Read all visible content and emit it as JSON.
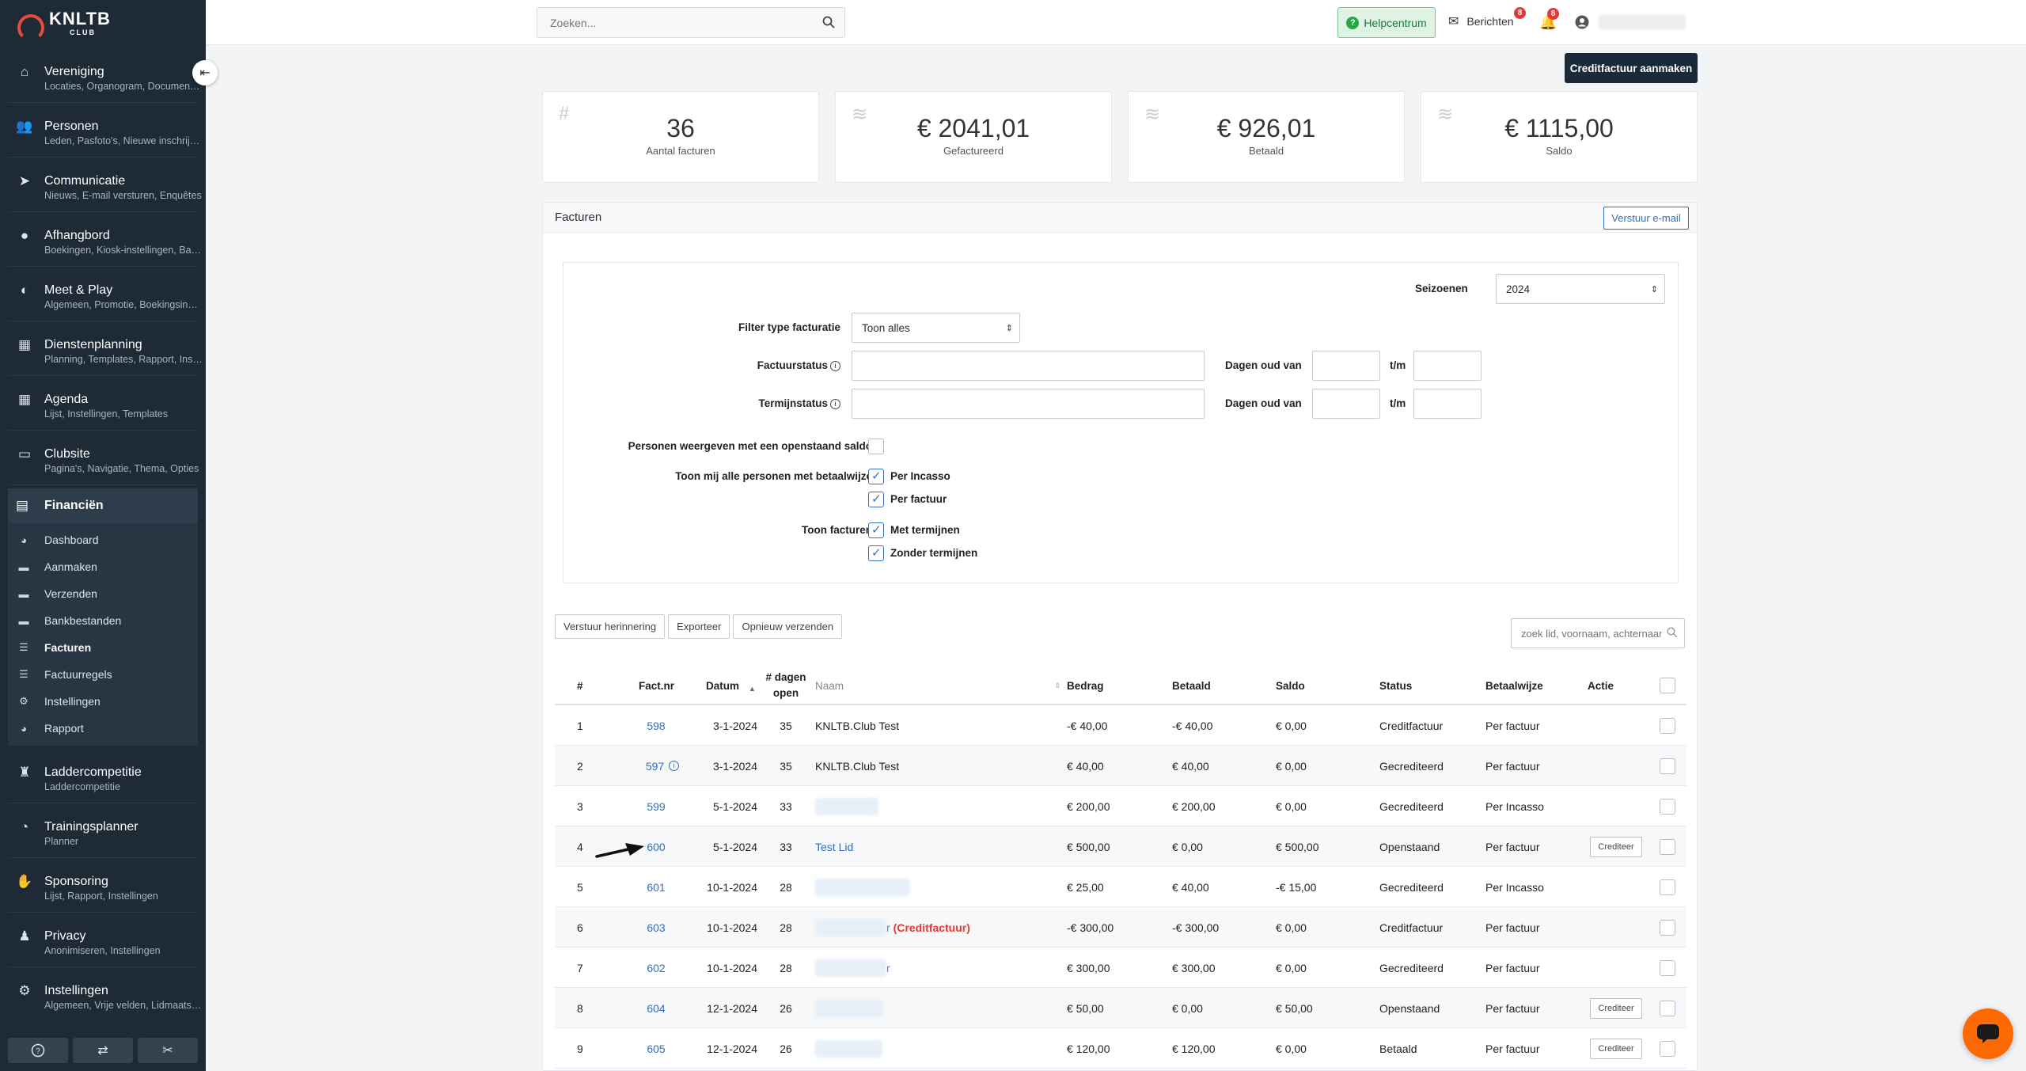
{
  "app": {
    "logo_text": "KNLTB",
    "logo_sub": "CLUB"
  },
  "sidebar": {
    "items": [
      {
        "label": "Vereniging",
        "sub": "Locaties, Organogram, Documenten",
        "icon": "home-icon"
      },
      {
        "label": "Personen",
        "sub": "Leden, Pasfoto's, Nieuwe inschrijvingen",
        "icon": "users-icon"
      },
      {
        "label": "Communicatie",
        "sub": "Nieuws, E-mail versturen, Enquêtes",
        "icon": "paper-plane-icon"
      },
      {
        "label": "Afhangbord",
        "sub": "Boekingen, Kiosk-instellingen, Banen",
        "icon": "ball-icon"
      },
      {
        "label": "Meet & Play",
        "sub": "Algemeen, Promotie, Boekingsinstellingen",
        "icon": "meet-play-icon"
      },
      {
        "label": "Dienstenplanning",
        "sub": "Planning, Templates, Rapport, Instellingen",
        "icon": "schedule-icon"
      },
      {
        "label": "Agenda",
        "sub": "Lijst, Instellingen, Templates",
        "icon": "calendar-icon"
      },
      {
        "label": "Clubsite",
        "sub": "Pagina's, Navigatie, Thema, Opties",
        "icon": "website-icon"
      }
    ],
    "finance": {
      "label": "Financiën",
      "items": [
        {
          "label": "Dashboard",
          "icon": "dashboard-icon"
        },
        {
          "label": "Aanmaken",
          "icon": "create-icon"
        },
        {
          "label": "Verzenden",
          "icon": "send-icon"
        },
        {
          "label": "Bankbestanden",
          "icon": "bank-file-icon"
        },
        {
          "label": "Facturen",
          "icon": "list-icon",
          "active": true
        },
        {
          "label": "Factuurregels",
          "icon": "list-icon"
        },
        {
          "label": "Instellingen",
          "icon": "settings-icon"
        },
        {
          "label": "Rapport",
          "icon": "report-icon"
        }
      ]
    },
    "items_after": [
      {
        "label": "Laddercompetitie",
        "sub": "Laddercompetitie",
        "icon": "trophy-icon"
      },
      {
        "label": "Trainingsplanner",
        "sub": "Planner",
        "icon": "training-icon"
      },
      {
        "label": "Sponsoring",
        "sub": "Lijst, Rapport, Instellingen",
        "icon": "sponsoring-icon"
      },
      {
        "label": "Privacy",
        "sub": "Anonimiseren, Instellingen",
        "icon": "privacy-icon"
      },
      {
        "label": "Instellingen",
        "sub": "Algemeen, Vrije velden, Lidmaatschappen",
        "icon": "settings-icon"
      }
    ]
  },
  "topbar": {
    "search_placeholder": "Zoeken...",
    "help_label": "Helpcentrum",
    "messages_label": "Berichten",
    "messages_count": "8",
    "notifications_count": "8"
  },
  "main": {
    "credit_button": "Creditfactuur aanmaken",
    "stats": [
      {
        "value": "36",
        "label": "Aantal facturen",
        "icon": "hash-icon"
      },
      {
        "value": "€ 2041,01",
        "label": "Gefactureerd",
        "icon": "coins-icon"
      },
      {
        "value": "€ 926,01",
        "label": "Betaald",
        "icon": "coins-icon"
      },
      {
        "value": "€ 1115,00",
        "label": "Saldo",
        "icon": "coins-icon"
      }
    ],
    "panel_title": "Facturen",
    "email_button": "Verstuur e-mail",
    "filters": {
      "season_label": "Seizoenen",
      "season_value": "2024",
      "type_label": "Filter type facturatie",
      "type_value": "Toon alles",
      "invoice_status_label": "Factuurstatus",
      "term_status_label": "Termijnstatus",
      "days_old_label": "Dagen oud van",
      "to_label": "t/m",
      "open_balance_label": "Personen weergeven met een openstaand saldo",
      "payment_method_label": "Toon mij alle personen met betaalwijze",
      "per_incasso": "Per Incasso",
      "per_factuur": "Per factuur",
      "show_invoices_label": "Toon facturen",
      "with_terms": "Met termijnen",
      "without_terms": "Zonder termijnen"
    },
    "actions": [
      "Verstuur herinnering",
      "Exporteer",
      "Opnieuw verzenden"
    ],
    "table_search_placeholder": "zoek lid, voornaam, achternaam",
    "table": {
      "headers": {
        "num": "#",
        "factnr": "Fact.nr",
        "datum": "Datum",
        "dagen": "# dagen open",
        "naam": "Naam",
        "bedrag": "Bedrag",
        "betaald": "Betaald",
        "saldo": "Saldo",
        "status": "Status",
        "betaalwijze": "Betaalwijze",
        "actie": "Actie"
      },
      "rows": [
        {
          "num": "1",
          "factnr": "598",
          "datum": "3-1-2024",
          "dagen": "35",
          "naam": "KNLTB.Club Test",
          "bedrag": "-€ 40,00",
          "betaald": "-€ 40,00",
          "saldo": "€ 0,00",
          "status": "Creditfactuur",
          "betaalwijze": "Per factuur"
        },
        {
          "num": "2",
          "factnr": "597",
          "datum": "3-1-2024",
          "dagen": "35",
          "naam": "KNLTB.Club Test",
          "bedrag": "€ 40,00",
          "betaald": "€ 40,00",
          "saldo": "€ 0,00",
          "status": "Gecrediteerd",
          "betaalwijze": "Per factuur"
        },
        {
          "num": "3",
          "factnr": "599",
          "datum": "5-1-2024",
          "dagen": "33",
          "naam": "",
          "bedrag": "€ 200,00",
          "betaald": "€ 200,00",
          "saldo": "€ 0,00",
          "status": "Gecrediteerd",
          "betaalwijze": "Per Incasso"
        },
        {
          "num": "4",
          "factnr": "600",
          "datum": "5-1-2024",
          "dagen": "33",
          "naam": "Test Lid",
          "bedrag": "€ 500,00",
          "betaald": "€ 0,00",
          "saldo": "€ 500,00",
          "status": "Openstaand",
          "betaalwijze": "Per factuur",
          "action": "Crediteer"
        },
        {
          "num": "5",
          "factnr": "601",
          "datum": "10-1-2024",
          "dagen": "28",
          "naam": "",
          "bedrag": "€ 25,00",
          "betaald": "€ 40,00",
          "saldo": "-€ 15,00",
          "status": "Gecrediteerd",
          "betaalwijze": "Per Incasso"
        },
        {
          "num": "6",
          "factnr": "603",
          "datum": "10-1-2024",
          "dagen": "28",
          "naam": "r",
          "naam_suffix": "(Creditfactuur)",
          "bedrag": "-€ 300,00",
          "betaald": "-€ 300,00",
          "saldo": "€ 0,00",
          "status": "Creditfactuur",
          "betaalwijze": "Per factuur"
        },
        {
          "num": "7",
          "factnr": "602",
          "datum": "10-1-2024",
          "dagen": "28",
          "naam": "r",
          "bedrag": "€ 300,00",
          "betaald": "€ 300,00",
          "saldo": "€ 0,00",
          "status": "Gecrediteerd",
          "betaalwijze": "Per factuur"
        },
        {
          "num": "8",
          "factnr": "604",
          "datum": "12-1-2024",
          "dagen": "26",
          "naam": "",
          "bedrag": "€ 50,00",
          "betaald": "€ 0,00",
          "saldo": "€ 50,00",
          "status": "Openstaand",
          "betaalwijze": "Per factuur",
          "action": "Crediteer"
        },
        {
          "num": "9",
          "factnr": "605",
          "datum": "12-1-2024",
          "dagen": "26",
          "naam": "",
          "bedrag": "€ 120,00",
          "betaald": "€ 120,00",
          "saldo": "€ 0,00",
          "status": "Betaald",
          "betaalwijze": "Per factuur",
          "action": "Crediteer"
        }
      ]
    }
  },
  "colors": {
    "sidebar": "#1e2a36",
    "link": "#2f6fc1",
    "chat": "#ff6a00",
    "credit_button": "#1b2a38"
  }
}
